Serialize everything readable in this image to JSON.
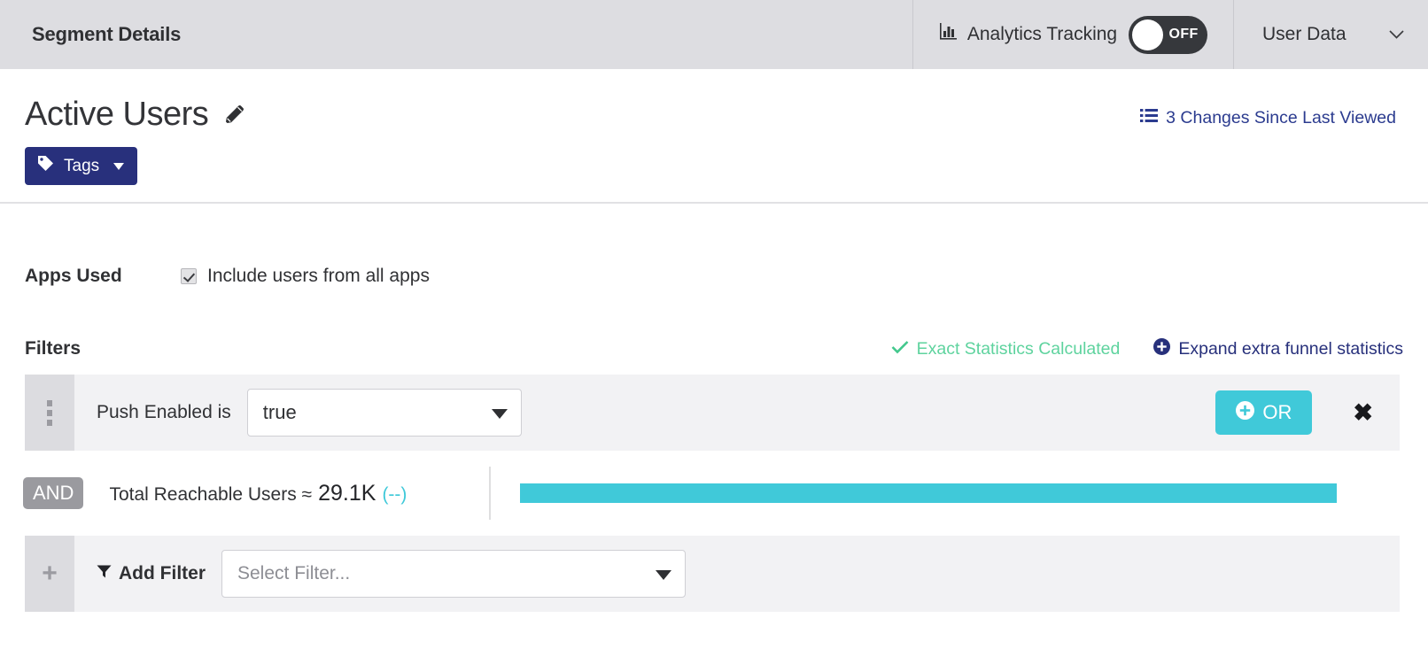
{
  "topbar": {
    "page_heading": "Segment Details",
    "analytics_icon": "bar-chart-icon",
    "analytics_label": "Analytics Tracking",
    "analytics_toggle_state": "OFF",
    "user_data_label": "User Data",
    "user_data_caret": "⌄"
  },
  "title": {
    "segment_name": "Active Users",
    "edit_icon": "pencil-icon",
    "changes_icon": "list-icon",
    "changes_link": "3 Changes Since Last Viewed",
    "tags_icon": "tag-icon",
    "tags_label": "Tags"
  },
  "apps_used": {
    "label": "Apps Used",
    "checkbox_checked": true,
    "checkbox_label": "Include users from all apps"
  },
  "filters": {
    "title": "Filters",
    "exact_stats_icon": "check-icon",
    "exact_stats_label": "Exact Statistics Calculated",
    "expand_icon": "plus-circle-icon",
    "expand_label": "Expand extra funnel statistics",
    "rows": [
      {
        "handle_icon": "drag-handle-icon",
        "label": "Push Enabled is",
        "select_value": "true",
        "or_icon": "plus-circle-icon",
        "or_label": "OR",
        "remove_icon": "close-icon",
        "remove_glyph": "✖"
      }
    ],
    "connector_badge": "AND",
    "reachable": {
      "label": "Total Reachable Users ≈",
      "value": "29.1K",
      "percent": "(--)",
      "bar_percent": 100
    },
    "add_filter": {
      "plus_glyph": "+",
      "funnel_icon": "funnel-icon",
      "label": "Add Filter",
      "placeholder": "Select Filter..."
    }
  },
  "colors": {
    "header_bg": "#dddde1",
    "navy": "#27307b",
    "cyan": "#40c9d9",
    "green": "#5ed39e",
    "row_bg": "#f2f2f4",
    "handle_bg": "#dcdce0",
    "and_badge": "#9a9a9f"
  }
}
